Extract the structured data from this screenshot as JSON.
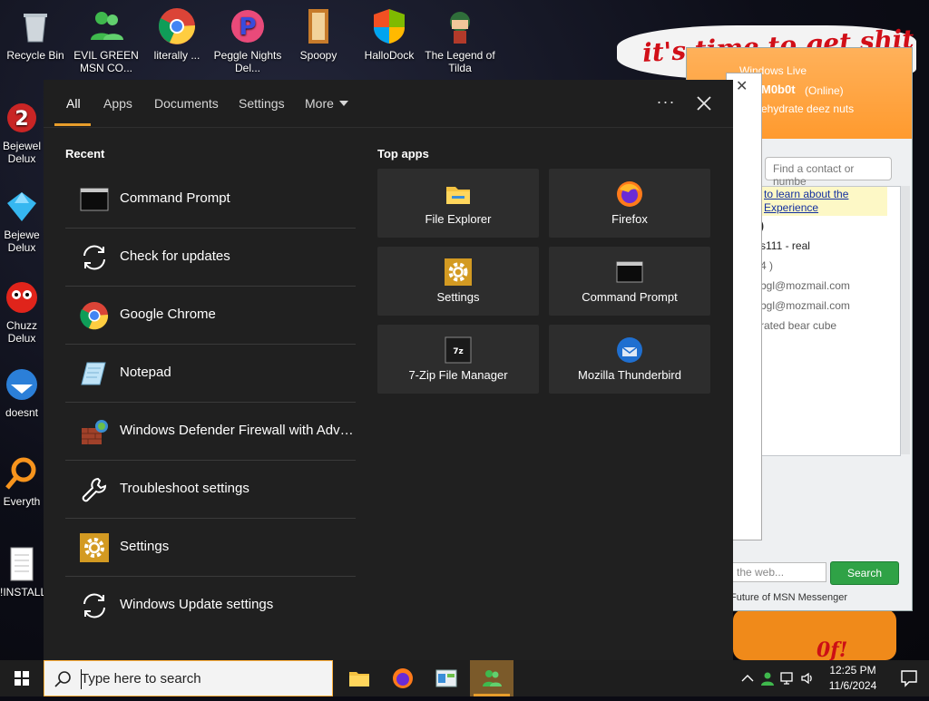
{
  "desktop": {
    "top_icons": [
      {
        "label": "Recycle Bin"
      },
      {
        "label": "EVIL GREEN MSN CO..."
      },
      {
        "label": "literally ..."
      },
      {
        "label": "Peggle Nights Del..."
      },
      {
        "label": "Spoopy"
      },
      {
        "label": "HalloDock"
      },
      {
        "label": "The Legend of Tilda"
      }
    ],
    "left_icons": [
      {
        "label": "Bejewel Delux"
      },
      {
        "label": "Bejewe Delux"
      },
      {
        "label": "Chuzz Delux"
      },
      {
        "label": "doesnt"
      },
      {
        "label": "Everyth"
      },
      {
        "label": "!INSTALL"
      }
    ],
    "wallpaper_text": "it's time to get shit",
    "wallpaper_bottom_text": "0f!"
  },
  "msn": {
    "title": "Windows Live",
    "name": "M0b0t",
    "status": "(Online)",
    "personal_message": "ehydrate deez nuts",
    "find_placeholder": "Find a contact or numbe",
    "notice": "to learn about the Experience",
    "contacts": [
      {
        "text": ")"
      },
      {
        "text": "s111 - real"
      },
      {
        "text": "4 )"
      },
      {
        "text": "bgl@mozmail.com"
      },
      {
        "text": "bgl@mozmail.com"
      },
      {
        "text": "rated bear cube"
      }
    ],
    "web_placeholder": "the web...",
    "search_label": "Search",
    "footer": "Future of MSN Messenger"
  },
  "panel": {
    "tabs": [
      {
        "label": "All"
      },
      {
        "label": "Apps"
      },
      {
        "label": "Documents"
      },
      {
        "label": "Settings"
      },
      {
        "label": "More"
      }
    ],
    "dots": "···",
    "recent_label": "Recent",
    "top_apps_label": "Top apps",
    "recent": [
      {
        "label": "Command Prompt",
        "icon": "command-prompt-icon"
      },
      {
        "label": "Check for updates",
        "icon": "sync-icon"
      },
      {
        "label": "Google Chrome",
        "icon": "chrome-icon"
      },
      {
        "label": "Notepad",
        "icon": "notepad-icon"
      },
      {
        "label": "Windows Defender Firewall with Advanced Security",
        "icon": "firewall-icon"
      },
      {
        "label": "Troubleshoot settings",
        "icon": "wrench-icon"
      },
      {
        "label": "Settings",
        "icon": "gear-icon"
      },
      {
        "label": "Windows Update settings",
        "icon": "sync-icon"
      }
    ],
    "top_apps": [
      {
        "label": "File Explorer",
        "icon": "folder-icon"
      },
      {
        "label": "Firefox",
        "icon": "firefox-icon"
      },
      {
        "label": "Settings",
        "icon": "gear-icon"
      },
      {
        "label": "Command Prompt",
        "icon": "command-prompt-icon"
      },
      {
        "label": "7-Zip File Manager",
        "icon": "7zip-icon"
      },
      {
        "label": "Mozilla Thunderbird",
        "icon": "thunderbird-icon"
      }
    ]
  },
  "taskbar": {
    "search_placeholder": "Type here to search",
    "time": "12:25 PM",
    "date": "11/6/2024"
  },
  "colors": {
    "accent": "#e89d2b",
    "panel_bg": "#202020",
    "tile_bg": "#2d2d2d"
  }
}
